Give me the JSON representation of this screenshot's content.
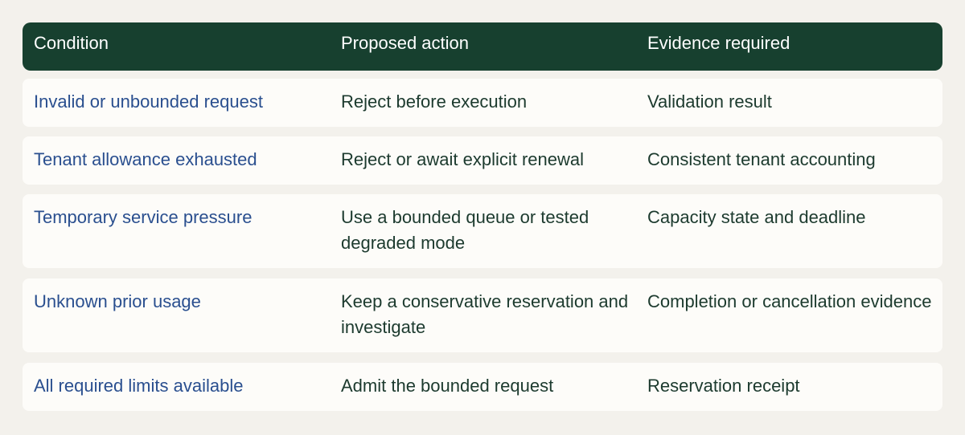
{
  "table": {
    "headers": [
      "Condition",
      "Proposed action",
      "Evidence required"
    ],
    "rows": [
      {
        "condition": "Invalid or unbounded request",
        "action": "Reject before execution",
        "evidence": "Validation result"
      },
      {
        "condition": "Tenant allowance exhausted",
        "action": "Reject or await explicit renewal",
        "evidence": "Consistent tenant accounting"
      },
      {
        "condition": "Temporary service pressure",
        "action": "Use a bounded queue or tested degraded mode",
        "evidence": "Capacity state and deadline"
      },
      {
        "condition": "Unknown prior usage",
        "action": "Keep a conservative reservation and investigate",
        "evidence": "Completion or cancellation evidence"
      },
      {
        "condition": "All required limits available",
        "action": "Admit the bounded request",
        "evidence": "Reservation receipt"
      }
    ]
  },
  "colors": {
    "header_bg": "#17402f",
    "condition_text": "#2a4f8f",
    "body_text": "#1c3a2e",
    "row_bg": "#fdfcf9",
    "page_bg": "#f3f1ec"
  }
}
